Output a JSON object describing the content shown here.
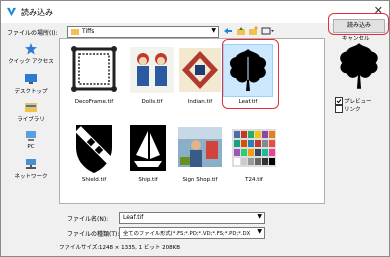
{
  "window": {
    "title": "読み込み",
    "close_glyph": "✕"
  },
  "location": {
    "label": "ファイルの場所(I):",
    "value": "Tiffs"
  },
  "places": [
    {
      "label": "クイック アクセス",
      "icon": "star-icon"
    },
    {
      "label": "デスクトップ",
      "icon": "desktop-icon"
    },
    {
      "label": "ライブラリ",
      "icon": "library-icon"
    },
    {
      "label": "PC",
      "icon": "pc-icon"
    },
    {
      "label": "ネットワーク",
      "icon": "network-icon"
    }
  ],
  "files": [
    {
      "name": "DecoFrame.tif"
    },
    {
      "name": "Dolls.tif"
    },
    {
      "name": "Indian.tif"
    },
    {
      "name": "Leaf.tif",
      "selected": true
    },
    {
      "name": "Shield.tif"
    },
    {
      "name": "Ship.tif"
    },
    {
      "name": "Sign Shop.tif"
    },
    {
      "name": "T24.tif"
    }
  ],
  "filename": {
    "label": "ファイル名(N):",
    "value": "Leaf.tif"
  },
  "filetype": {
    "label": "ファイルの種類(T):",
    "value": "全てのファイル形式(*.FS;*.PD;*.VD;*.FS;*.PD;*.DX"
  },
  "filesize": {
    "label": "ファイルサイズ:",
    "value": "1248 × 1335, 1 ビット  208KB"
  },
  "buttons": {
    "open": "読み込み",
    "cancel": "キャンセル"
  },
  "options": {
    "preview": "プレビュー",
    "link": "リンク",
    "preview_checked": true,
    "link_checked": false
  },
  "colors": {
    "highlight": "#e0303a",
    "selection": "#cce8ff",
    "folder": "#f2c14e"
  }
}
